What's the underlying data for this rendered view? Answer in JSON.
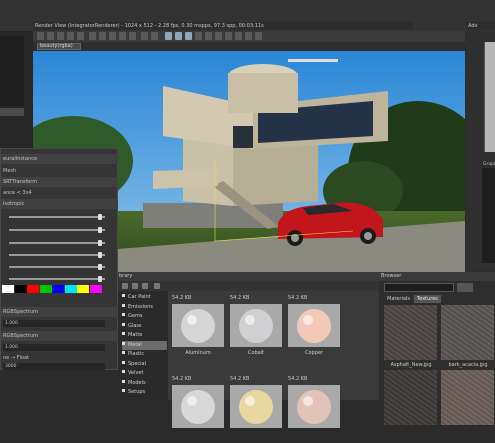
{
  "render_view": {
    "title": "Render View (IntegratorRenderer) - 1024 x 512 - 2.28 fps, 0.30 mspps, 97.3 spp, 00:03:11s",
    "tab": "beauty(rgba)"
  },
  "right_panel": {
    "tab": "Adv",
    "graph_label": "Graph"
  },
  "properties": {
    "rows": [
      "euralInstance",
      "Mesh",
      "SRTTransform",
      "ance  <   3x4",
      "Isotropic"
    ],
    "slider_values": [
      0.97,
      0.97,
      0.97,
      0.97,
      0.97,
      0.97
    ],
    "color_swatches": [
      "#ffffff",
      "#000000",
      "#ff0000",
      "#00c800",
      "#0000ff",
      "#00e5ff",
      "#ffff00",
      "#ff00ff"
    ],
    "spectrum_rows": [
      "RGBSpectrum",
      "RGBSpectrum"
    ],
    "fields": [
      "1.000",
      "1.000",
      "3000"
    ],
    "bottom_row": "ne  →  Float"
  },
  "library": {
    "title": "brary",
    "tree": [
      "Car Paint",
      "Emissions",
      "Gems",
      "Glass",
      "Matte",
      "Metal",
      "Plastic",
      "Special",
      "Velvet",
      "Models",
      "Setups"
    ],
    "selected_index": 5,
    "materials": [
      {
        "size": "54.2 KB",
        "label": "Aluminum"
      },
      {
        "size": "54.2 KB",
        "label": "Cobalt"
      },
      {
        "size": "54.2 KB",
        "label": "Copper"
      },
      {
        "size": "54.2 KB",
        "label": ""
      },
      {
        "size": "54.2 KB",
        "label": ""
      },
      {
        "size": "54.2 KB",
        "label": ""
      }
    ]
  },
  "browser": {
    "title": "Browser",
    "tabs": [
      "Materials",
      "Textures"
    ],
    "active_tab": 1,
    "textures": [
      {
        "label": "Asphalt_New.jpg"
      },
      {
        "label": "bark_acacia.jpg"
      },
      {
        "label": ""
      },
      {
        "label": ""
      }
    ]
  }
}
